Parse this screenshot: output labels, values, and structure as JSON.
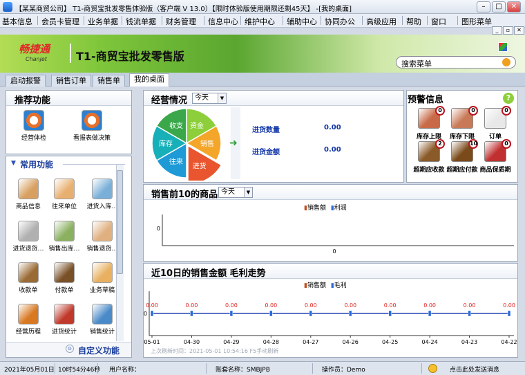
{
  "window": {
    "title": "【某某商贸公司】 T1-商贸宝批发零售体验版（客户端 V 13.0）【限时体验版使用期限还剩45天】 -[我的桌面]",
    "min_glyph": "–",
    "max_glyph": "□",
    "close_glyph": "✕"
  },
  "menu": [
    "基本信息",
    "会员卡管理",
    "业务单据",
    "钱流单据",
    "财务管理",
    "信息中心",
    "维护中心",
    "辅助中心",
    "协同办公",
    "高级应用",
    "帮助",
    "窗口",
    "图形菜单"
  ],
  "mdi_glyphs": [
    "_",
    "▫",
    "✕"
  ],
  "banner": {
    "logo": "畅捷通",
    "logo_sub": "Chanjet",
    "product": "T1-商贸宝批发零售版",
    "search_placeholder": "搜索菜单"
  },
  "tabs": [
    {
      "label": "启动报警"
    },
    {
      "label": "销售订单"
    },
    {
      "label": "销售单"
    },
    {
      "label": "我的桌面",
      "active": true
    }
  ],
  "recommend": {
    "title": "推荐功能",
    "items": [
      {
        "label": "经营体检",
        "icon": "health-check-icon"
      },
      {
        "label": "看报表做决策",
        "icon": "report-decision-icon"
      }
    ]
  },
  "common": {
    "title": "常用功能",
    "items": [
      {
        "label": "商品信息",
        "icon": "goods-icon",
        "color": "#d8a060"
      },
      {
        "label": "往来单位",
        "icon": "partner-icon",
        "color": "#e8b070"
      },
      {
        "label": "进货入库…",
        "icon": "purchase-in-icon",
        "color": "#7ab0d8"
      },
      {
        "label": "进货退货…",
        "icon": "purchase-return-icon",
        "color": "#b0b0b0"
      },
      {
        "label": "销售出库…",
        "icon": "sales-out-icon",
        "color": "#8ab060"
      },
      {
        "label": "销售退货…",
        "icon": "sales-return-icon",
        "color": "#e0b080"
      },
      {
        "label": "收款单",
        "icon": "receipt-icon",
        "color": "#9a6b34"
      },
      {
        "label": "付款单",
        "icon": "payment-icon",
        "color": "#7a5026"
      },
      {
        "label": "业务草稿",
        "icon": "draft-icon",
        "color": "#e8b060"
      },
      {
        "label": "经营历程",
        "icon": "history-icon",
        "color": "#d87820"
      },
      {
        "label": "进货统计",
        "icon": "purchase-stats-icon",
        "color": "#c0392b"
      },
      {
        "label": "销售统计",
        "icon": "sales-stats-icon",
        "color": "#4a8ac8"
      }
    ],
    "custom_label": "自定义功能"
  },
  "business": {
    "title": "经营情况",
    "period": "今天",
    "wheel": [
      "资金",
      "销售",
      "进货",
      "往来",
      "库存",
      "收支"
    ],
    "stats": [
      {
        "label": "进货数量",
        "value": "0.00"
      },
      {
        "label": "进货金额",
        "value": "0.00"
      }
    ]
  },
  "alerts": {
    "title": "预警信息",
    "help_glyph": "?",
    "items": [
      {
        "label": "库存上限",
        "count": "0",
        "icon": "stock-upper-icon"
      },
      {
        "label": "库存下限",
        "count": "0",
        "icon": "stock-lower-icon"
      },
      {
        "label": "订单",
        "count": "0",
        "icon": "order-icon"
      },
      {
        "label": "超期应收款",
        "count": "2",
        "icon": "overdue-receivable-icon"
      },
      {
        "label": "超期应付款",
        "count": "10",
        "icon": "overdue-payable-icon"
      },
      {
        "label": "商品保质期",
        "count": "0",
        "icon": "shelf-life-icon"
      }
    ]
  },
  "top10": {
    "title": "销售前10的商品",
    "period": "今天",
    "legend": [
      "销售额",
      "利润"
    ]
  },
  "trend": {
    "title": "近10日的销售金额  毛利走势",
    "legend": [
      "销售额",
      "毛利"
    ],
    "footer": "上次刷新时间：2021-05-01 10:54:16    F5手动刷新"
  },
  "status": {
    "date": "2021年05月01日",
    "time": "10时54分46秒",
    "user": "用户名称：",
    "account": "账套名称：SMBJPB",
    "operator": "操作员：Demo",
    "message": "点击此处发送消息"
  },
  "colors": {
    "chart_red": "#e02020",
    "chart_blue": "#2a6ad8",
    "wheel": [
      "#8ccf3a",
      "#f4a62a",
      "#e8552e",
      "#1e9ad6",
      "#18b0b8",
      "#3aa84a"
    ]
  },
  "chart_data": [
    {
      "type": "bar",
      "title": "销售前10的商品",
      "categories": [],
      "series": [
        {
          "name": "销售额",
          "values": []
        },
        {
          "name": "利润",
          "values": []
        }
      ],
      "y_ticks": [
        "0"
      ],
      "x_ticks": [
        "0"
      ]
    },
    {
      "type": "line",
      "title": "近10日的销售金额  毛利走势",
      "categories": [
        "05-01",
        "04-30",
        "04-29",
        "04-28",
        "04-27",
        "04-26",
        "04-25",
        "04-24",
        "04-23",
        "04-22"
      ],
      "series": [
        {
          "name": "销售额",
          "values": [
            0,
            0,
            0,
            0,
            0,
            0,
            0,
            0,
            0,
            0
          ],
          "labels": [
            "0.00",
            "0.00",
            "0.00",
            "0.00",
            "0.00",
            "0.00",
            "0.00",
            "0.00",
            "0.00",
            "0.00"
          ]
        },
        {
          "name": "毛利",
          "values": [
            0,
            0,
            0,
            0,
            0,
            0,
            0,
            0,
            0,
            0
          ]
        }
      ],
      "y_ticks": [
        "0"
      ]
    }
  ]
}
